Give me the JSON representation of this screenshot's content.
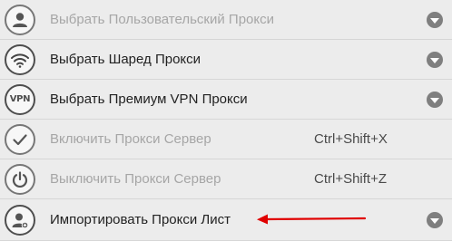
{
  "menu": {
    "items": [
      {
        "label": "Выбрать Пользовательский Прокси",
        "icon": "user-icon",
        "enabled": false,
        "has_submenu": true
      },
      {
        "label": "Выбрать Шаред Прокси",
        "icon": "wifi-icon",
        "enabled": true,
        "has_submenu": true
      },
      {
        "label": "Выбрать Премиум VPN Прокси",
        "icon": "vpn-icon",
        "icon_text": "VPN",
        "enabled": true,
        "has_submenu": true
      },
      {
        "label": "Включить Прокси Сервер",
        "icon": "checkmark-icon",
        "enabled": false,
        "shortcut": "Ctrl+Shift+X"
      },
      {
        "label": "Выключить Прокси Сервер",
        "icon": "power-icon",
        "enabled": false,
        "shortcut": "Ctrl+Shift+Z"
      },
      {
        "label": "Импортировать Прокси Лист",
        "icon": "import-user-icon",
        "enabled": true,
        "has_submenu": true
      }
    ]
  },
  "colors": {
    "background": "#ececec",
    "text": "#222222",
    "disabled_text": "#a6a6a6",
    "annotation_arrow": "#e00000"
  }
}
